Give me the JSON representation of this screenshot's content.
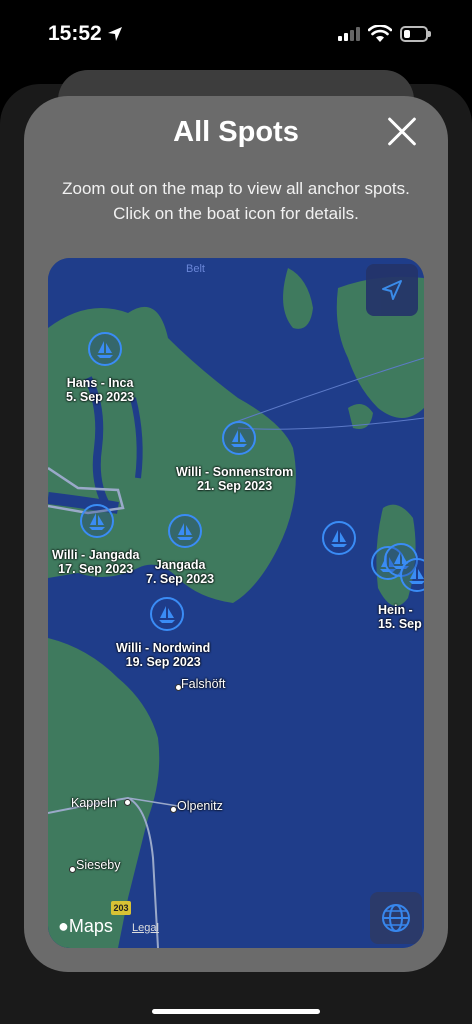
{
  "status_bar": {
    "time": "15:52"
  },
  "sheet": {
    "title": "All Spots",
    "subtitle": "Zoom out on the map to view all anchor spots. Click on the boat icon for details."
  },
  "map": {
    "sea_label": "Belt",
    "places": {
      "falshoft": "Falshöft",
      "kappeln": "Kappeln",
      "olpenitz": "Olpenitz",
      "sieseby": "Sieseby"
    },
    "road_number": "203",
    "maps_brand": "Maps",
    "legal": "Legal",
    "spots": [
      {
        "name": "Hans - Inca",
        "date": "5. Sep 2023"
      },
      {
        "name": "Willi - Sonnenstrom",
        "date": "21. Sep 2023"
      },
      {
        "name": "Willi - Jangada",
        "date": "17. Sep 2023"
      },
      {
        "name": "Jangada",
        "date": "7. Sep 2023"
      },
      {
        "name": "Willi - Nordwind",
        "date": "19. Sep 2023"
      },
      {
        "name": "Hein -",
        "date": "15. Sep"
      }
    ]
  },
  "icons": [
    "location-arrow-icon",
    "cellular-signal-icon",
    "wifi-icon",
    "battery-icon",
    "close-icon",
    "boat-icon",
    "globe-icon",
    "apple-icon"
  ],
  "colors": {
    "sea": "#1f3d8a",
    "land": "#3f7a5e",
    "marker": "#3a8cf5",
    "sheet": "#6b6b6b"
  }
}
